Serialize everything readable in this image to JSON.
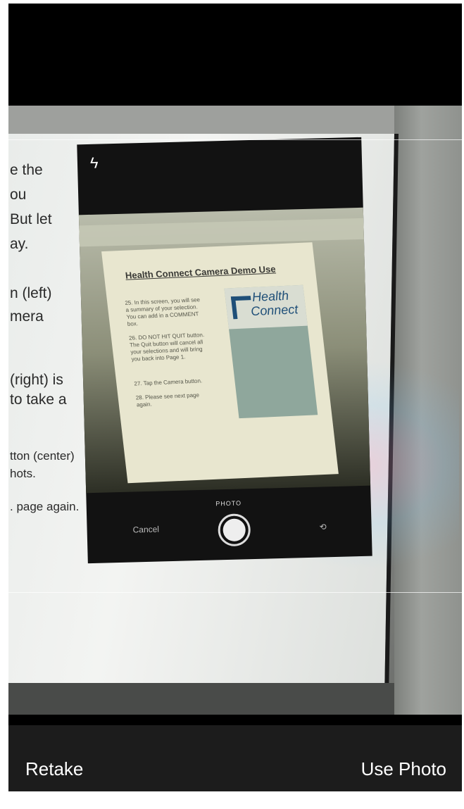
{
  "bottom_bar": {
    "retake_label": "Retake",
    "use_photo_label": "Use Photo"
  },
  "photo": {
    "instruction_lines": [
      "e the",
      "ou",
      " But let",
      "ay.",
      "n (left)",
      "mera",
      "(right) is",
      "to take a",
      "tton (center)",
      "hots.",
      ". page again."
    ],
    "inner_phone": {
      "mode_label": "PHOTO",
      "cancel_label": "Cancel",
      "flash_icon": "flash-icon",
      "switch_icon": "camera-switch-icon",
      "document_title": "Health Connect Camera Demo Use",
      "logo_text_line1": "Health",
      "logo_text_line2": "Connect",
      "items": [
        "25. In this screen, you will see a summary of your selection. You can add in a COMMENT box.",
        "26. DO NOT HIT QUIT button. The Quit button will cancel all your selections and will bring you back into Page 1.",
        "27. Tap the Camera button.",
        "28. Please see next page again."
      ]
    }
  },
  "colors": {
    "bar_background": "#1c1c1c",
    "label_color": "#ffffff",
    "logo_blue": "#1f4f78"
  }
}
